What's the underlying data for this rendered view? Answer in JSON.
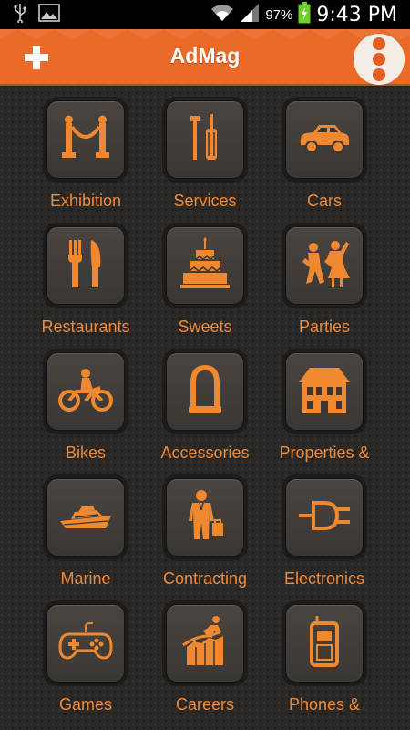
{
  "status_bar": {
    "battery_percent": "97%",
    "time": "9:43 PM",
    "icons": [
      "usb-icon",
      "image-icon",
      "wifi-icon",
      "signal-icon",
      "battery-icon"
    ]
  },
  "app_bar": {
    "title": "AdMag",
    "add_icon": "plus-icon",
    "menu_icon": "overflow-menu-icon",
    "accent_color": "#ea6a2a"
  },
  "categories": [
    {
      "label": "Exhibition",
      "icon": "exhibition-icon"
    },
    {
      "label": "Services",
      "icon": "tools-icon"
    },
    {
      "label": "Cars",
      "icon": "car-icon"
    },
    {
      "label": "Restaurants",
      "icon": "fork-knife-icon"
    },
    {
      "label": "Sweets",
      "icon": "cake-icon"
    },
    {
      "label": "Parties",
      "icon": "dancing-icon"
    },
    {
      "label": "Bikes",
      "icon": "motorbike-icon"
    },
    {
      "label": "Accessories",
      "icon": "lock-icon"
    },
    {
      "label": "Properties &",
      "icon": "building-icon"
    },
    {
      "label": "Marine",
      "icon": "yacht-icon"
    },
    {
      "label": "Contracting",
      "icon": "worker-icon"
    },
    {
      "label": "Electronics",
      "icon": "plug-icon"
    },
    {
      "label": "Games",
      "icon": "gamepad-icon"
    },
    {
      "label": "Careers",
      "icon": "career-growth-icon"
    },
    {
      "label": "Phones &",
      "icon": "phone-icon"
    }
  ],
  "colors": {
    "label": "#ef8a3a",
    "icon": "#f0882f",
    "background": "#2a2825"
  }
}
